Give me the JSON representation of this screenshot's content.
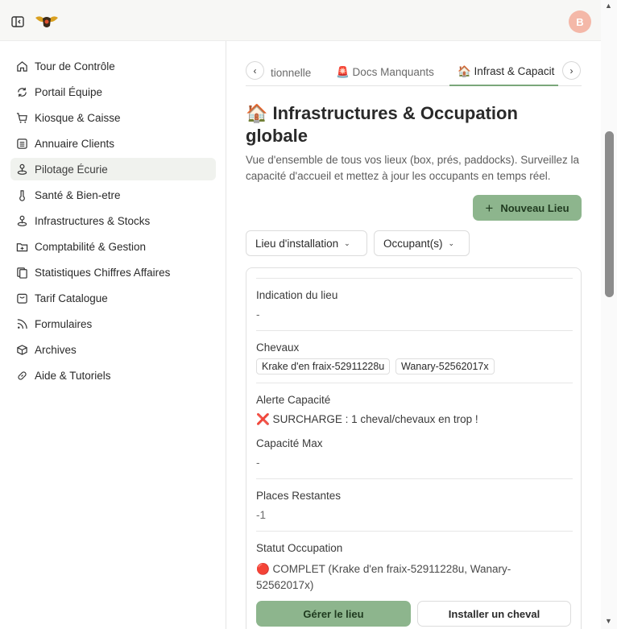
{
  "topbar": {
    "avatar_initial": "B",
    "toggle_icon": "sidebar-toggle-icon",
    "logo_icon": "winged-horseshoe-logo"
  },
  "sidebar": {
    "items": [
      {
        "label": "Tour de Contrôle",
        "icon": "home-icon",
        "active": false
      },
      {
        "label": "Portail Équipe",
        "icon": "refresh-icon",
        "active": false
      },
      {
        "label": "Kiosque & Caisse",
        "icon": "cart-icon",
        "active": false
      },
      {
        "label": "Annuaire Clients",
        "icon": "list-icon",
        "active": false
      },
      {
        "label": "Pilotage Écurie",
        "icon": "location-icon",
        "active": true
      },
      {
        "label": "Santé & Bien-etre",
        "icon": "thermometer-icon",
        "active": false
      },
      {
        "label": "Infrastructures & Stocks",
        "icon": "location-icon",
        "active": false
      },
      {
        "label": "Comptabilité & Gestion",
        "icon": "folder-icon",
        "active": false
      },
      {
        "label": "Statistiques Chiffres Affaires",
        "icon": "database-icon",
        "active": false
      },
      {
        "label": "Tarif Catalogue",
        "icon": "calendar-icon",
        "active": false
      },
      {
        "label": "Formulaires",
        "icon": "rss-icon",
        "active": false
      },
      {
        "label": "Archives",
        "icon": "box-icon",
        "active": false
      },
      {
        "label": "Aide & Tutoriels",
        "icon": "link-icon",
        "active": false
      }
    ]
  },
  "tabs": {
    "items": [
      {
        "label": "tionnelle"
      },
      {
        "label": "🚨 Docs Manquants"
      },
      {
        "label": "🏠 Infrast & Capacit",
        "active": true
      }
    ]
  },
  "page": {
    "title": "🏠 Infrastructures & Occupation globale",
    "description": "Vue d'ensemble de tous vos lieux (box, prés, paddocks). Surveillez la capacité d'accueil et mettez à jour les occupants en temps réel.",
    "new_button": "Nouveau Lieu",
    "filters": [
      "Lieu d'installation",
      "Occupant(s)"
    ]
  },
  "card": {
    "indication_label": "Indication du lieu",
    "indication_value": "-",
    "horses_label": "Chevaux",
    "horses": [
      "Krake d'en fraix-52911228u",
      "Wanary-52562017x"
    ],
    "alert_label": "Alerte Capacité",
    "alert_value": "❌ SURCHARGE : 1 cheval/chevaux en trop !",
    "capacity_label": "Capacité Max",
    "capacity_value": "-",
    "remaining_label": "Places Restantes",
    "remaining_value": "-1",
    "status_label": "Statut Occupation",
    "status_value": "🔴 COMPLET (Krake d'en fraix-52911228u, Wanary-52562017x)",
    "manage_button": "Gérer le lieu",
    "install_button": "Installer un cheval"
  },
  "colors": {
    "accent": "#8db58d",
    "active_nav": "#f0f2ee",
    "avatar": "#f4b8a8"
  }
}
